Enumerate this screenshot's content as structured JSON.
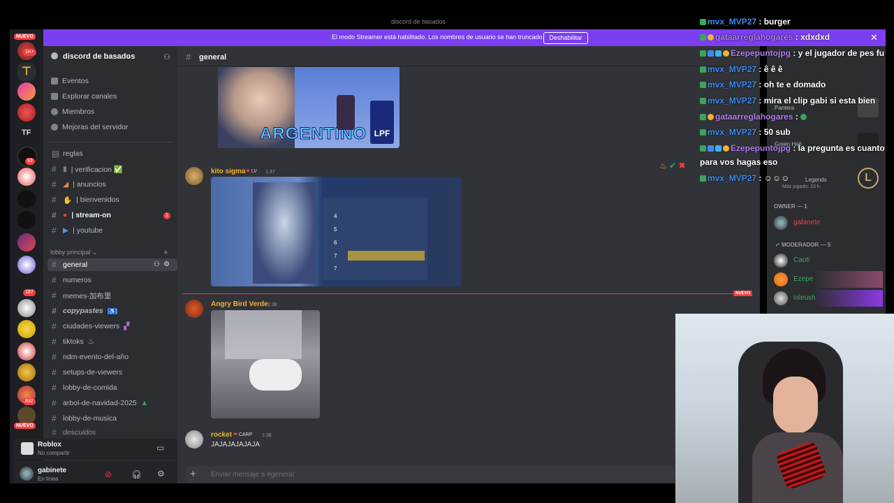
{
  "window": {
    "title": "discord de basados"
  },
  "banner": {
    "text": "El modo Streamer está habilitado. Los nombres de usuario se han truncado.",
    "button": "Deshabilitar"
  },
  "rail": {
    "nuevo_top": "NUEVO",
    "nuevo_bottom": "NUEVO",
    "badges": [
      "1K+",
      "1",
      "1",
      "3",
      "93",
      "11",
      "1",
      "1",
      "187",
      "1",
      "2",
      "11",
      "3",
      "832",
      "3"
    ],
    "tf_label": "TF"
  },
  "sidebar": {
    "server_name": "discord de basados",
    "menu": [
      "Eventos",
      "Explorar canales",
      "Miembros",
      "Mejoras del servidor"
    ],
    "rules_channel": "reglas",
    "channels_top": [
      "| verificacion ✅",
      "| anuncios",
      "| bienvenidos",
      "| stream-on",
      "| youtube"
    ],
    "stream_badge": "1",
    "category": "lobby principal",
    "channels": [
      "general",
      "numeros",
      "memes-加布里",
      "copypastes",
      "ciudades-viewers",
      "tiktoks",
      "ndm-evento-del-año",
      "setups-de-viewers",
      "lobby-de-comida",
      "arbol-de-navidad-2025",
      "lobby-de-musica",
      "descuidos"
    ]
  },
  "voice": {
    "title": "Roblox",
    "subtitle": "No compartir"
  },
  "user": {
    "name": "gabinete",
    "status": "En línea"
  },
  "chat": {
    "channel": "general",
    "banner_image_text": "ARGENTINO",
    "banner_logo": "LPF",
    "messages": [
      {
        "user": "kito sigma",
        "tag": "LV",
        "time": "1:37",
        "color": "#f0b232"
      },
      {
        "user": "Angry Bird Verde",
        "time": "1:38",
        "color": "#f0b232"
      },
      {
        "user": "rocket",
        "tag": "CARP",
        "time": "1:38",
        "text": "JAJAJAJAJAJA",
        "color": "#f0b232"
      }
    ],
    "new_label": "NUEVO",
    "composer_placeholder": "Enviar mensaje a #general"
  },
  "ranking_rows": [
    "4",
    "5",
    "6",
    "7",
    "7"
  ],
  "members": {
    "activity": [
      "Pantera",
      "Green Hell",
      "Legends",
      "Más jugado: 23 h"
    ],
    "owner_header": "OWNER — 1",
    "owner": "gabinete",
    "mod_header": "MODERADOR — 5",
    "mods": [
      "Caoti",
      "Ezepe",
      "loleush"
    ]
  },
  "overlay": [
    {
      "user": "mvx_MVP27",
      "text": ": burger",
      "color": "#3c8cf0"
    },
    {
      "user": "gataarreglahogares",
      "text": ": xdxdxd",
      "color": "#9b6cf0"
    },
    {
      "user": "Ezepepuntojpg",
      "text": ": y el jugador de pes fu",
      "color": "#9b6cf0"
    },
    {
      "user": "mvx_MVP27",
      "text": ": ê ê ê",
      "color": "#3c8cf0"
    },
    {
      "user": "mvx_MVP27",
      "text": ": oh te e domado",
      "color": "#3c8cf0"
    },
    {
      "user": "mvx_MVP27",
      "text": ": mira el clip gabi si esta bien",
      "color": "#3c8cf0"
    },
    {
      "user": "gataarreglahogares",
      "text": ":",
      "color": "#9b6cf0"
    },
    {
      "user": "mvx_MVP27",
      "text": ": 50 sub",
      "color": "#3c8cf0"
    },
    {
      "user": "Ezepepuntojpg",
      "text": ": la pregunta es cuanto",
      "color": "#9b6cf0"
    },
    {
      "user": "",
      "text": "para vos hagas eso",
      "color": "#ffffff"
    },
    {
      "user": "mvx_MVP27",
      "text": ":",
      "color": "#3c8cf0"
    }
  ]
}
